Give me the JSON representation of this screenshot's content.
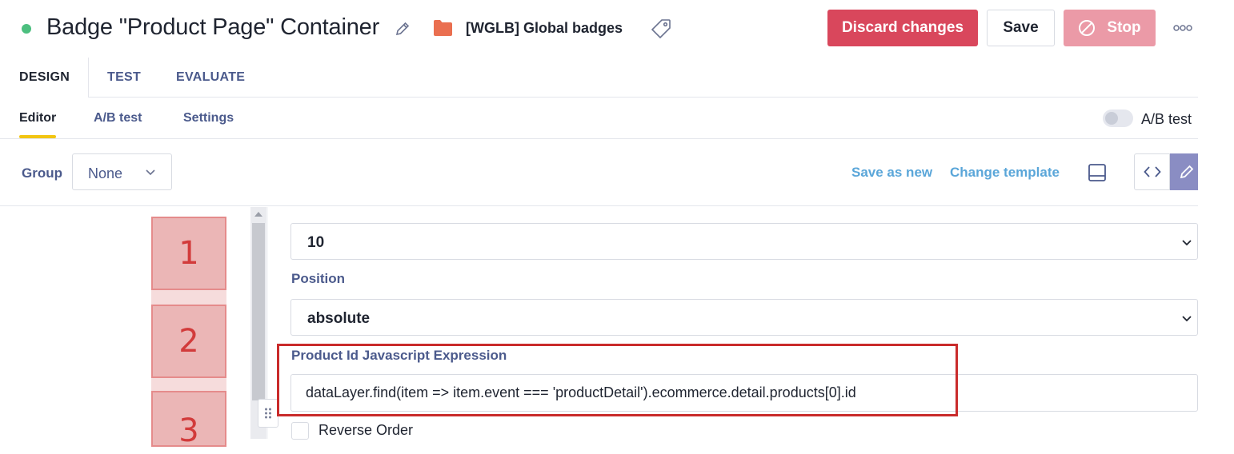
{
  "header": {
    "title": "Badge \"Product Page\" Container",
    "folder_label": "[WGLB] Global badges",
    "discard_label": "Discard changes",
    "save_label": "Save",
    "stop_label": "Stop",
    "status_color": "#4cbf7f",
    "folder_color": "#ea6f50",
    "discard_color": "#d9475c",
    "stop_color": "#eb9aa7"
  },
  "primary_tabs": [
    {
      "label": "DESIGN",
      "active": true
    },
    {
      "label": "TEST",
      "active": false
    },
    {
      "label": "EVALUATE",
      "active": false
    }
  ],
  "secondary_tabs": [
    {
      "label": "Editor",
      "active": true
    },
    {
      "label": "A/B test",
      "active": false
    },
    {
      "label": "Settings",
      "active": false
    }
  ],
  "ab_toggle": {
    "label": "A/B test",
    "enabled": false
  },
  "toolbar": {
    "group_label": "Group",
    "group_value": "None",
    "save_as_new": "Save as new",
    "change_template": "Change template",
    "accent_color": "#5aa6d9",
    "edit_mode_color": "#8a8dc3"
  },
  "preview": {
    "badges": [
      "1",
      "2",
      "3"
    ],
    "badge_color": "#ebb6b6",
    "badge_text_color": "#d23b3b"
  },
  "form": {
    "zindex_value": "10",
    "position_label": "Position",
    "position_value": "absolute",
    "expression_label": "Product Id Javascript Expression",
    "expression_value": "dataLayer.find(item => item.event === 'productDetail').ecommerce.detail.products[0].id",
    "reverse_order_label": "Reverse Order",
    "reverse_order_checked": false,
    "highlight_color": "#c92b2b"
  },
  "icons": {
    "title_edit": "pencil-icon",
    "folder": "folder-icon",
    "tag": "tag-icon",
    "stop": "circle-slash-icon",
    "more": "more-dots-icon",
    "panel": "panel-bottom-icon",
    "code": "code-brackets-icon",
    "edit": "pencil-icon",
    "drag": "drag-handle-icon"
  }
}
